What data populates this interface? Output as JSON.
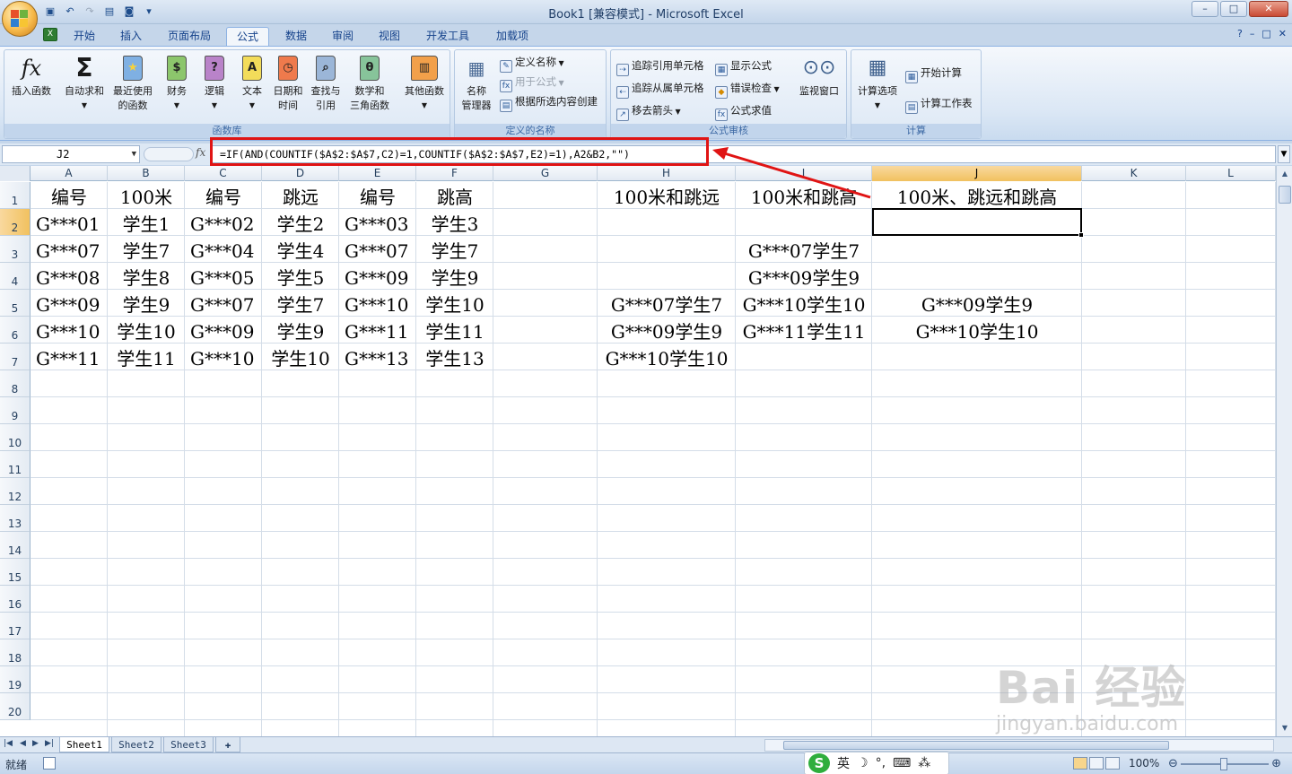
{
  "window": {
    "title": "Book1  [兼容模式] - Microsoft Excel",
    "controls": [
      "–",
      "□",
      "✕"
    ]
  },
  "tabs": [
    {
      "label": "开始",
      "active": false
    },
    {
      "label": "插入",
      "active": false
    },
    {
      "label": "页面布局",
      "active": false
    },
    {
      "label": "公式",
      "active": true
    },
    {
      "label": "数据",
      "active": false
    },
    {
      "label": "审阅",
      "active": false
    },
    {
      "label": "视图",
      "active": false
    },
    {
      "label": "开发工具",
      "active": false
    },
    {
      "label": "加载项",
      "active": false
    }
  ],
  "ribbon": {
    "function_library": {
      "label": "函数库",
      "insert_function": "插入函数",
      "autosum": "自动求和",
      "recent_1": "最近使用",
      "recent_2": "的函数",
      "financial": "财务",
      "logical": "逻辑",
      "text": "文本",
      "datetime_1": "日期和",
      "datetime_2": "时间",
      "lookup_1": "查找与",
      "lookup_2": "引用",
      "math_1": "数学和",
      "math_2": "三角函数",
      "more": "其他函数"
    },
    "defined_names": {
      "label": "定义的名称",
      "name_manager_1": "名称",
      "name_manager_2": "管理器",
      "define_name": "定义名称",
      "use_in_formula": "用于公式",
      "create_from_selection": "根据所选内容创建"
    },
    "formula_auditing": {
      "label": "公式审核",
      "trace_precedents": "追踪引用单元格",
      "trace_dependents": "追踪从属单元格",
      "remove_arrows": "移去箭头",
      "show_formulas": "显示公式",
      "error_checking": "错误检查",
      "evaluate_formula": "公式求值",
      "watch_window": "监视窗口"
    },
    "calculation": {
      "label": "计算",
      "calc_options": "计算选项",
      "calc_now": "开始计算",
      "calc_sheet": "计算工作表"
    }
  },
  "formula_bar": {
    "name_box": "J2",
    "fx": "fx",
    "formula": "=IF(AND(COUNTIF($A$2:$A$7,C2)=1,COUNTIF($A$2:$A$7,E2)=1),A2&B2,\"\")"
  },
  "grid": {
    "columns": [
      "A",
      "B",
      "C",
      "D",
      "E",
      "F",
      "G",
      "H",
      "I",
      "J",
      "K",
      "L"
    ],
    "selected_column": "J",
    "selected_row": "2",
    "rows": [
      "1",
      "2",
      "3",
      "4",
      "5",
      "6",
      "7",
      "8",
      "9",
      "10",
      "11",
      "12",
      "13",
      "14",
      "15",
      "16",
      "17",
      "18",
      "19",
      "20"
    ],
    "cells": {
      "A": [
        "编号",
        "G***01",
        "G***07",
        "G***08",
        "G***09",
        "G***10",
        "G***11"
      ],
      "B": [
        "100米",
        "学生1",
        "学生7",
        "学生8",
        "学生9",
        "学生10",
        "学生11"
      ],
      "C": [
        "编号",
        "G***02",
        "G***04",
        "G***05",
        "G***07",
        "G***09",
        "G***10"
      ],
      "D": [
        "跳远",
        "学生2",
        "学生4",
        "学生5",
        "学生7",
        "学生9",
        "学生10"
      ],
      "E": [
        "编号",
        "G***03",
        "G***07",
        "G***09",
        "G***10",
        "G***11",
        "G***13"
      ],
      "F": [
        "跳高",
        "学生3",
        "学生7",
        "学生9",
        "学生10",
        "学生11",
        "学生13"
      ],
      "H": [
        "100米和跳远",
        "",
        "",
        "",
        "G***07学生7",
        "G***09学生9",
        "G***10学生10"
      ],
      "I": [
        "100米和跳高",
        "",
        "G***07学生7",
        "G***09学生9",
        "G***10学生10",
        "G***11学生11",
        ""
      ],
      "J": [
        "100米、跳远和跳高",
        "",
        "",
        "",
        "G***09学生9",
        "G***10学生10",
        ""
      ]
    }
  },
  "sheets": [
    {
      "label": "Sheet1",
      "active": true
    },
    {
      "label": "Sheet2",
      "active": false
    },
    {
      "label": "Sheet3",
      "active": false
    }
  ],
  "status": {
    "ready": "就绪",
    "zoom": "100%",
    "ime": "英"
  },
  "watermark": {
    "brand": "Bai 经验",
    "url": "jingyan.baidu.com"
  }
}
